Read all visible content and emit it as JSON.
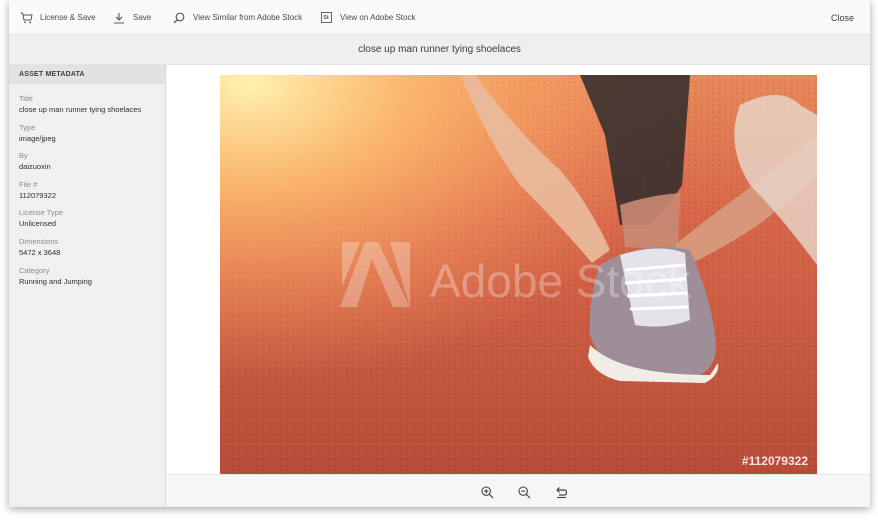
{
  "toolbar": {
    "license_save": {
      "label": "License & Save",
      "icon": "cart-icon"
    },
    "save": {
      "label": "Save",
      "icon": "download-icon"
    },
    "view_similar": {
      "label": "View Similar from Adobe Stock",
      "icon": "search-icon"
    },
    "view_on_stock": {
      "label": "View on Adobe Stock",
      "icon": "stock-icon",
      "icon_text": "St"
    },
    "close_label": "Close"
  },
  "title": "close up man runner tying shoelaces",
  "sidebar": {
    "heading": "ASSET METADATA",
    "items": [
      {
        "label": "Title",
        "value": "close up man runner tying shoelaces"
      },
      {
        "label": "Type",
        "value": "image/jpeg"
      },
      {
        "label": "By",
        "value": "daizuoxin"
      },
      {
        "label": "File #",
        "value": "112079322"
      },
      {
        "label": "License Type",
        "value": "Unlicensed"
      },
      {
        "label": "Dimensions",
        "value": "5472 x 3648"
      },
      {
        "label": "Category",
        "value": "Running and Jumping"
      }
    ]
  },
  "preview": {
    "watermark_text": "Adobe Stock",
    "file_tag": "#112079322"
  },
  "zoom": {
    "icons": [
      "zoom-in-icon",
      "zoom-out-icon",
      "reset-zoom-icon"
    ]
  },
  "colors": {
    "track": "#c0543e",
    "glow": "#ffd070"
  }
}
